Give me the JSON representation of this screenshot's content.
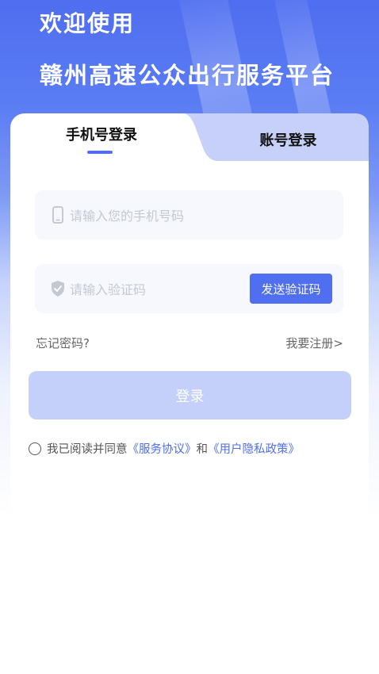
{
  "header": {
    "welcome": "欢迎使用",
    "platform_name": "赣州高速公众出行服务平台"
  },
  "tabs": {
    "phone_login": "手机号登录",
    "account_login": "账号登录"
  },
  "form": {
    "phone_placeholder": "请输入您的手机号码",
    "code_placeholder": "请输入验证码",
    "send_code": "发送验证码",
    "forgot_password": "忘记密码?",
    "register": "我要注册>",
    "login": "登录"
  },
  "agreement": {
    "prefix": "我已阅读并同意",
    "service": "《服务协议》",
    "and": "和",
    "privacy": "《用户隐私政策》"
  },
  "colors": {
    "accent": "#4f6ef0",
    "login_disabled": "#c4cffa"
  },
  "icons": {
    "phone": "phone-icon",
    "shield": "shield-check-icon"
  }
}
